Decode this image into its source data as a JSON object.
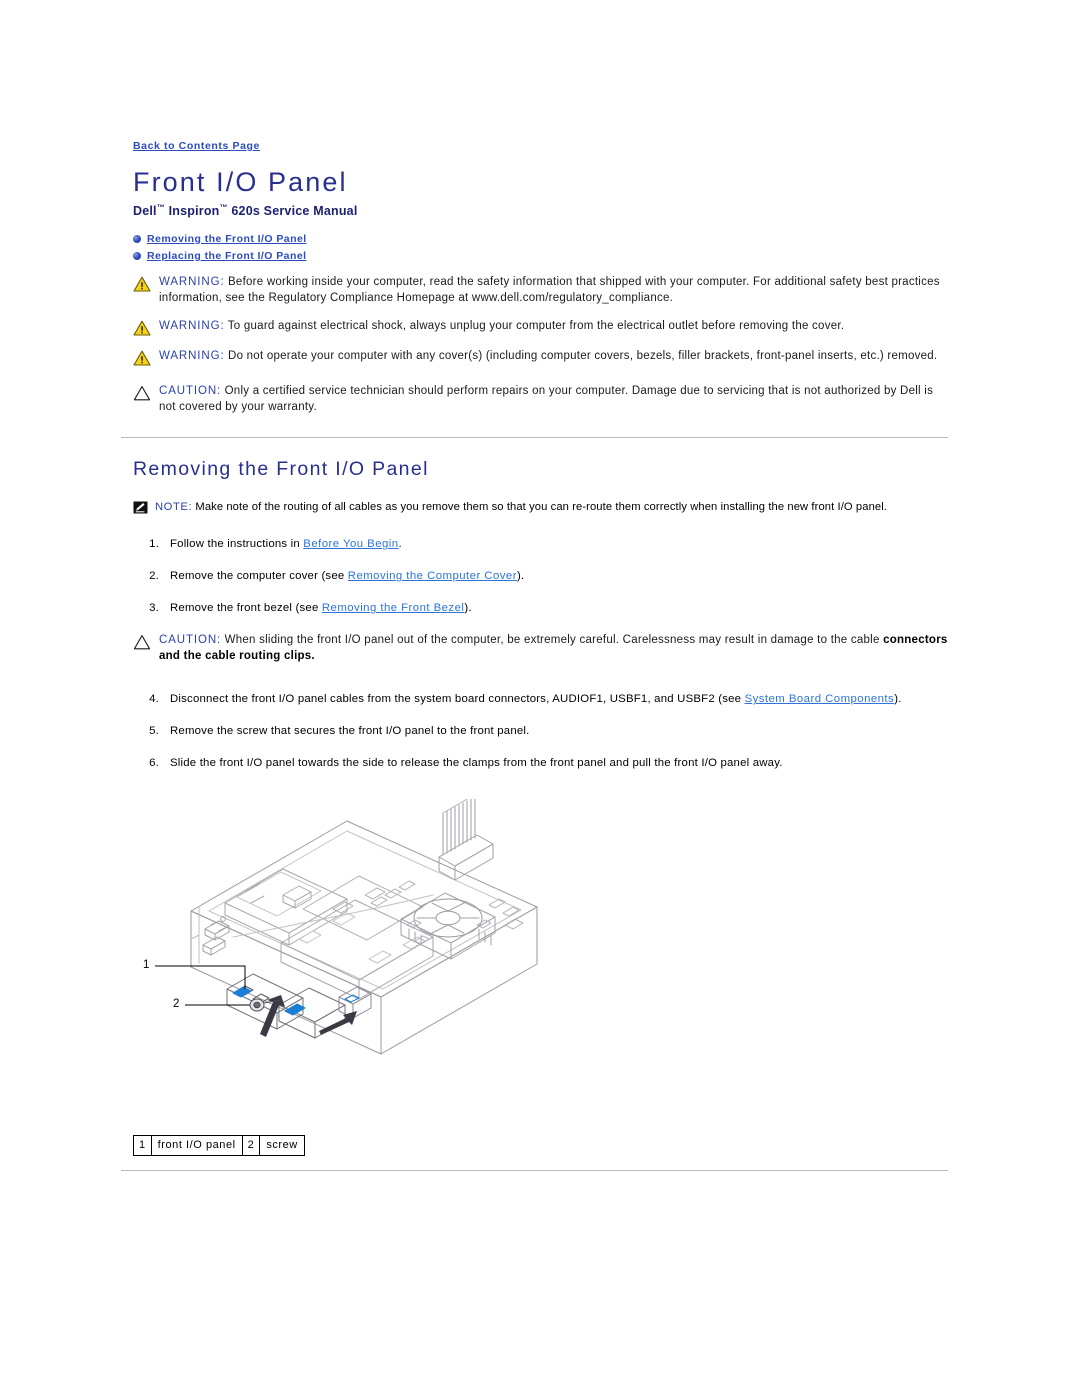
{
  "page": {
    "back_link": "Back to Contents Page",
    "title": "Front I/O Panel",
    "subtitle_pre": "Dell",
    "subtitle_tm1": "™",
    "subtitle_mid": " Inspiron",
    "subtitle_tm2": "™",
    "subtitle_post": " 620s Service Manual"
  },
  "anchors": [
    {
      "label": "Removing the Front I/O Panel",
      "icon": "bullet-sphere-icon"
    },
    {
      "label": "Replacing the Front I/O Panel",
      "icon": "bullet-sphere-icon"
    }
  ],
  "admonitions": [
    {
      "kind": "warning",
      "icon": "warning-triangle-icon",
      "keyword": "WARNING:",
      "text": " Before working inside your computer, read the safety information that shipped with your computer. For additional safety best practices information, see the Regulatory Compliance Homepage at www.dell.com/regulatory_compliance."
    },
    {
      "kind": "warning",
      "icon": "warning-triangle-icon",
      "keyword": "WARNING:",
      "text": " To guard against electrical shock, always unplug your computer from the electrical outlet before removing the cover."
    },
    {
      "kind": "warning",
      "icon": "warning-triangle-icon",
      "keyword": "WARNING:",
      "text": " Do not operate your computer with any cover(s) (including computer covers, bezels, filler brackets, front-panel inserts, etc.) removed."
    },
    {
      "kind": "caution",
      "icon": "caution-triangle-icon",
      "keyword": "CAUTION:",
      "text": " Only a certified service technician should perform repairs on your computer. Damage due to servicing that is not authorized by Dell is not covered by your warranty."
    }
  ],
  "section": {
    "heading": "Removing the Front I/O Panel",
    "note": {
      "icon": "note-pencil-icon",
      "keyword": "NOTE:",
      "text": " Make note of the routing of all cables as you remove them so that you can re-route them correctly when installing the new front I/O panel."
    },
    "caution_mid": {
      "icon": "caution-triangle-icon",
      "keyword": "CAUTION:",
      "text": " When sliding the front I/O panel out of the computer, be extremely careful. Carelessness may result in damage to the cable ",
      "bold_text": "connectors and the cable routing clips."
    }
  },
  "steps_part1": [
    {
      "num": "1.",
      "pre": "Follow the instructions in ",
      "link": "Before You Begin",
      "post": "."
    },
    {
      "num": "2.",
      "pre": "Remove the computer cover (see ",
      "link": "Removing the Computer Cover",
      "post": ")."
    },
    {
      "num": "3.",
      "pre": "Remove the front bezel (see ",
      "link": "Removing the Front Bezel",
      "post": ")."
    }
  ],
  "steps_part2": [
    {
      "num": "4.",
      "pre": "Disconnect the front I/O panel cables from the system board connectors, AUDIOF1, USBF1, and USBF2 (see ",
      "link": "System Board Components",
      "post": ")."
    },
    {
      "num": "5.",
      "pre": "Remove the screw that secures the front I/O panel to the front panel.",
      "link": "",
      "post": ""
    },
    {
      "num": "6.",
      "pre": "Slide the front I/O panel towards the side to release the clamps from the front panel and pull the front I/O panel away.",
      "link": "",
      "post": ""
    }
  ],
  "figure": {
    "callouts": [
      {
        "number": "1"
      },
      {
        "number": "2"
      }
    ]
  },
  "legend": [
    {
      "number": "1",
      "label": "front I/O panel"
    },
    {
      "number": "2",
      "label": "screw"
    }
  ],
  "colors": {
    "title_blue": "#292f8f",
    "link_blue": "#2b4bbd",
    "xref_blue": "#2e74d8",
    "keyword_blue": "#2b3fa8",
    "warning_yellow": "#f5d21c",
    "rule_gray": "#b9b9b9",
    "highlight_blue": "#1a7fd4"
  }
}
